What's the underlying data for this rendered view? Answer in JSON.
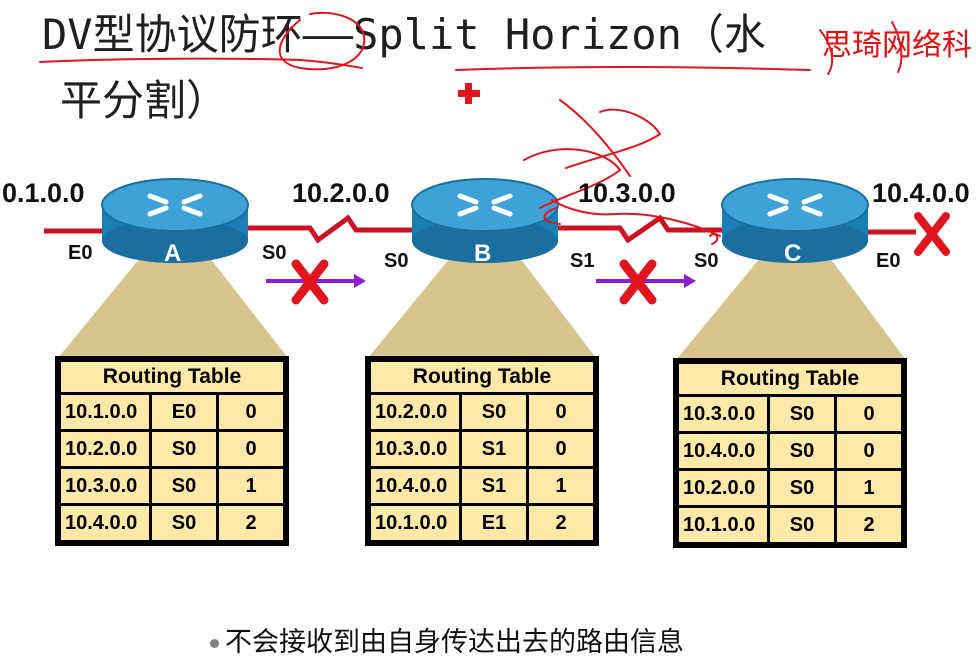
{
  "title": {
    "line1": "DV型协议防环——Split Horizon（水",
    "line2": "平分割）"
  },
  "watermark": "思琦网络科",
  "networks": [
    "0.1.0.0",
    "10.2.0.0",
    "10.3.0.0",
    "10.4.0.0"
  ],
  "routers": [
    {
      "label": "A",
      "left_if": "E0",
      "right_if": "S0"
    },
    {
      "label": "B",
      "left_if": "S0",
      "right_if": "S1"
    },
    {
      "label": "C",
      "left_if": "S0",
      "right_if": "E0"
    }
  ],
  "routing_tables": [
    {
      "title": "Routing Table",
      "rows": [
        [
          "10.1.0.0",
          "E0",
          "0"
        ],
        [
          "10.2.0.0",
          "S0",
          "0"
        ],
        [
          "10.3.0.0",
          "S0",
          "1"
        ],
        [
          "10.4.0.0",
          "S0",
          "2"
        ]
      ]
    },
    {
      "title": "Routing Table",
      "rows": [
        [
          "10.2.0.0",
          "S0",
          "0"
        ],
        [
          "10.3.0.0",
          "S1",
          "0"
        ],
        [
          "10.4.0.0",
          "S1",
          "1"
        ],
        [
          "10.1.0.0",
          "E1",
          "2"
        ]
      ]
    },
    {
      "title": "Routing Table",
      "rows": [
        [
          "10.3.0.0",
          "S0",
          "0"
        ],
        [
          "10.4.0.0",
          "S0",
          "0"
        ],
        [
          "10.2.0.0",
          "S0",
          "1"
        ],
        [
          "10.1.0.0",
          "S0",
          "2"
        ]
      ]
    }
  ],
  "caption": "不会接收到由自身传达出去的路由信息",
  "colors": {
    "router_body": "#1a7fb5",
    "router_top": "#3fa2d6",
    "table_fill": "#ffe9a8",
    "cone_fill": "#d8c58e",
    "link_red": "#cc1122",
    "arrow_purple": "#8b1fc9",
    "x_red": "#e0161e"
  }
}
